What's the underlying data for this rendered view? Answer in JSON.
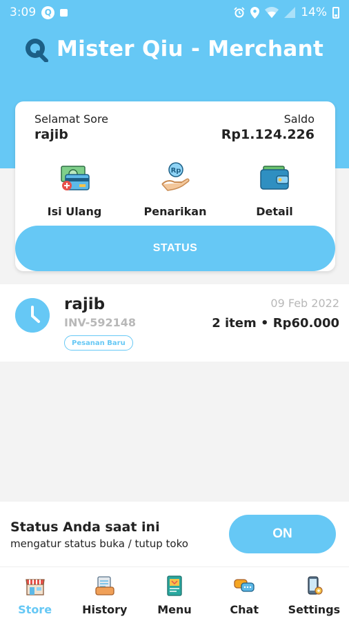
{
  "status_bar": {
    "time": "3:09",
    "battery": "14%"
  },
  "app": {
    "title": "Mister Qiu - Merchant",
    "logo_icon": "q-logo-icon"
  },
  "card": {
    "greeting": "Selamat Sore",
    "name": "rajib",
    "saldo_label": "Saldo",
    "saldo_value": "Rp1.124.226",
    "actions": [
      {
        "label": "Isi Ulang",
        "icon": "money-topup-icon"
      },
      {
        "label": "Penarikan",
        "icon": "hand-coin-icon"
      },
      {
        "label": "Detail",
        "icon": "wallet-icon"
      }
    ],
    "status_button": "STATUS"
  },
  "order": {
    "name": "rajib",
    "invoice": "INV-592148",
    "badge": "Pesanan Baru",
    "date": "09 Feb 2022",
    "summary": "2 item • Rp60.000",
    "icon": "clock-icon"
  },
  "store_status": {
    "title": "Status Anda saat ini",
    "subtitle": "mengatur status buka / tutup toko",
    "toggle_label": "ON"
  },
  "nav": [
    {
      "label": "Store",
      "icon": "store-icon",
      "active": true
    },
    {
      "label": "History",
      "icon": "history-icon",
      "active": false
    },
    {
      "label": "Menu",
      "icon": "menu-book-icon",
      "active": false
    },
    {
      "label": "Chat",
      "icon": "chat-icon",
      "active": false
    },
    {
      "label": "Settings",
      "icon": "settings-phone-icon",
      "active": false
    }
  ],
  "colors": {
    "accent": "#66c8f5",
    "background": "#f3f3f3"
  }
}
